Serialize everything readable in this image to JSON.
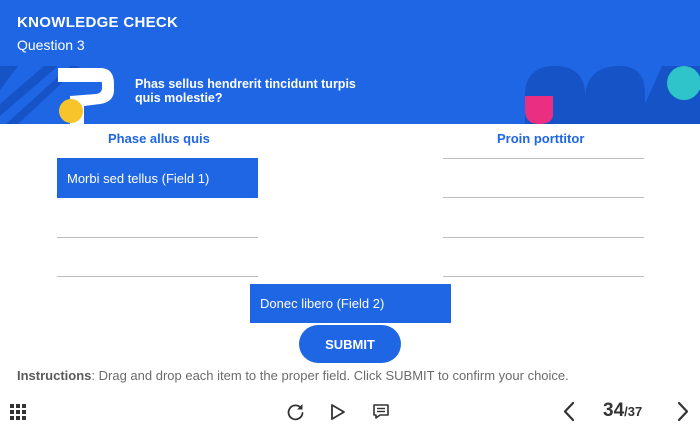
{
  "header": {
    "title": "KNOWLEDGE CHECK",
    "subtitle": "Question 3",
    "question": "Phas sellus hendrerit tincidunt turpis quis molestie?"
  },
  "columns": {
    "left_heading": "Phase allus quis",
    "right_heading": "Proin porttitor"
  },
  "drag_items": [
    {
      "label": "Morbi sed tellus (Field 1)"
    },
    {
      "label": "Donec libero (Field 2)"
    }
  ],
  "submit_label": "SUBMIT",
  "instructions": {
    "label": "Instructions",
    "text": ": Drag and drop each item to the proper field. Click SUBMIT to confirm your choice."
  },
  "footer": {
    "page_current": "34",
    "page_separator": "/",
    "page_total": "37",
    "icons": [
      "grid-menu-icon",
      "replay-icon",
      "play-icon",
      "transcript-icon",
      "previous-icon",
      "next-icon"
    ]
  },
  "colors": {
    "primary": "#1f66e5",
    "accent_yellow": "#f7c42c",
    "accent_pink": "#ea2f82",
    "accent_teal": "#2ec4c9",
    "dark_blue": "#1553c6"
  }
}
